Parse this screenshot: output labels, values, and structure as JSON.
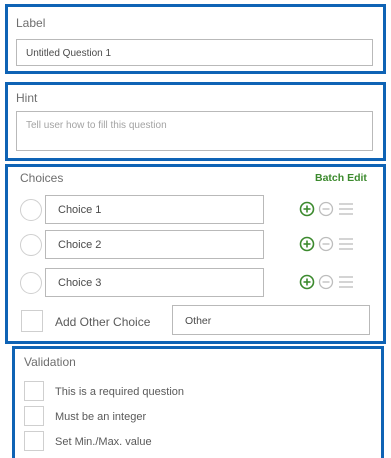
{
  "label_panel": {
    "title": "Label",
    "value": "Untitled Question 1"
  },
  "hint_panel": {
    "title": "Hint",
    "placeholder": "Tell user how to fill this question"
  },
  "choices_panel": {
    "title": "Choices",
    "batch_edit_label": "Batch Edit",
    "choices": [
      {
        "label": "Choice 1"
      },
      {
        "label": "Choice 2"
      },
      {
        "label": "Choice 3"
      }
    ],
    "add_other_label": "Add Other Choice",
    "other_value": "Other"
  },
  "validation_panel": {
    "title": "Validation",
    "options": [
      {
        "label": "This is a required question"
      },
      {
        "label": "Must be an integer"
      },
      {
        "label": "Set Min./Max. value"
      }
    ]
  },
  "colors": {
    "panel_border": "#0e63b5",
    "add_icon": "#3c8a2e",
    "remove_icon": "#bdbdbd",
    "batch_edit": "#3c8a2e"
  },
  "icons": {
    "add": "plus-circle-icon",
    "remove": "minus-circle-icon",
    "reorder": "drag-handle-icon"
  }
}
